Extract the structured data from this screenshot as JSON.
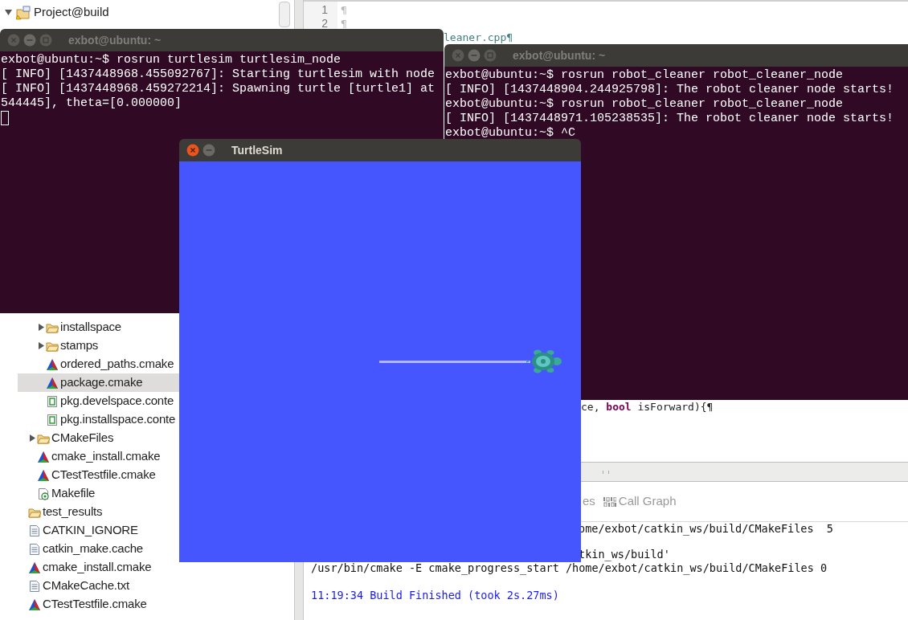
{
  "ide": {
    "project_explorer": {
      "root": {
        "label": "Project@build",
        "expanded": true,
        "selected": false
      },
      "items": [
        {
          "children": [
            {
              "children": [
                {
                  "label": "installspace",
                  "kind": "folder",
                  "expanded": false,
                  "selected": false
                },
                {
                  "label": "stamps",
                  "kind": "folder",
                  "expanded": false,
                  "selected": false
                },
                {
                  "label": "ordered_paths.cmake",
                  "kind": "cmake",
                  "selected": false
                },
                {
                  "label": "package.cmake",
                  "kind": "cmake",
                  "selected": true
                },
                {
                  "label": "pkg.develspace.conte",
                  "kind": "pkg",
                  "selected": false
                },
                {
                  "label": "pkg.installspace.conte",
                  "kind": "pkg",
                  "selected": false
                }
              ]
            },
            {
              "label": "CMakeFiles",
              "kind": "folder",
              "expanded": false,
              "selected": false
            },
            {
              "label": "cmake_install.cmake",
              "kind": "cmake",
              "selected": false
            },
            {
              "label": "CTestTestfile.cmake",
              "kind": "cmake",
              "selected": false
            },
            {
              "label": "Makefile",
              "kind": "makefile",
              "selected": false
            }
          ]
        },
        {
          "label": "test_results",
          "kind": "folder",
          "selected": false
        },
        {
          "label": "CATKIN_IGNORE",
          "kind": "text",
          "selected": false
        },
        {
          "label": "catkin_make.cache",
          "kind": "text",
          "selected": false
        },
        {
          "label": "cmake_install.cmake",
          "kind": "cmake",
          "selected": false
        },
        {
          "label": "CMakeCache.txt",
          "kind": "text",
          "selected": false
        },
        {
          "label": "CTestTestfile.cmake",
          "kind": "cmake",
          "selected": false
        }
      ]
    },
    "editor": {
      "lines": [
        {
          "number": "1",
          "text": "¶"
        },
        {
          "number": "2",
          "text": "¶"
        }
      ],
      "fragments": [
        "leaner.cpp¶",
        "ce, **bool** isForward){¶"
      ]
    },
    "console": {
      "tabs": [
        {
          "label": "es",
          "kind": "plain"
        },
        {
          "label": "Call Graph",
          "kind": "binary"
        }
      ],
      "lines": [
        {
          "text": "ome/exbot/catkin_ws/build/CMakeFiles  5",
          "kind": "output"
        },
        {
          "text": "tkin_ws/build'",
          "kind": "output"
        },
        {
          "text": "/usr/bin/cmake -E cmake_progress_start /home/exbot/catkin_ws/build/CMakeFiles 0",
          "kind": "output"
        },
        {
          "text": "11:19:34 Build Finished (took 2s.27ms)",
          "kind": "status"
        }
      ]
    }
  },
  "windows": [
    {
      "kind": "terminal",
      "title": "exbot@ubuntu: ~",
      "active": false,
      "cursor": true,
      "lines": [
        "exbot@ubuntu:~$ rosrun turtlesim turtlesim_node",
        "[ INFO] [1437448968.455092767]: Starting turtlesim with node",
        "[ INFO] [1437448968.459272214]: Spawning turtle [turtle1] at",
        "544445], theta=[0.000000]"
      ]
    },
    {
      "kind": "terminal",
      "title": "exbot@ubuntu: ~",
      "active": false,
      "lines": [
        "exbot@ubuntu:~$ rosrun robot_cleaner robot_cleaner_node",
        "[ INFO] [1437448904.244925798]: The robot cleaner node starts!",
        "exbot@ubuntu:~$ rosrun robot_cleaner robot_cleaner_node",
        "[ INFO] [1437448971.105238535]: The robot cleaner node starts!",
        "exbot@ubuntu:~$ ^C"
      ]
    },
    {
      "kind": "turtlesim",
      "title": "TurtleSim",
      "active": true
    }
  ]
}
